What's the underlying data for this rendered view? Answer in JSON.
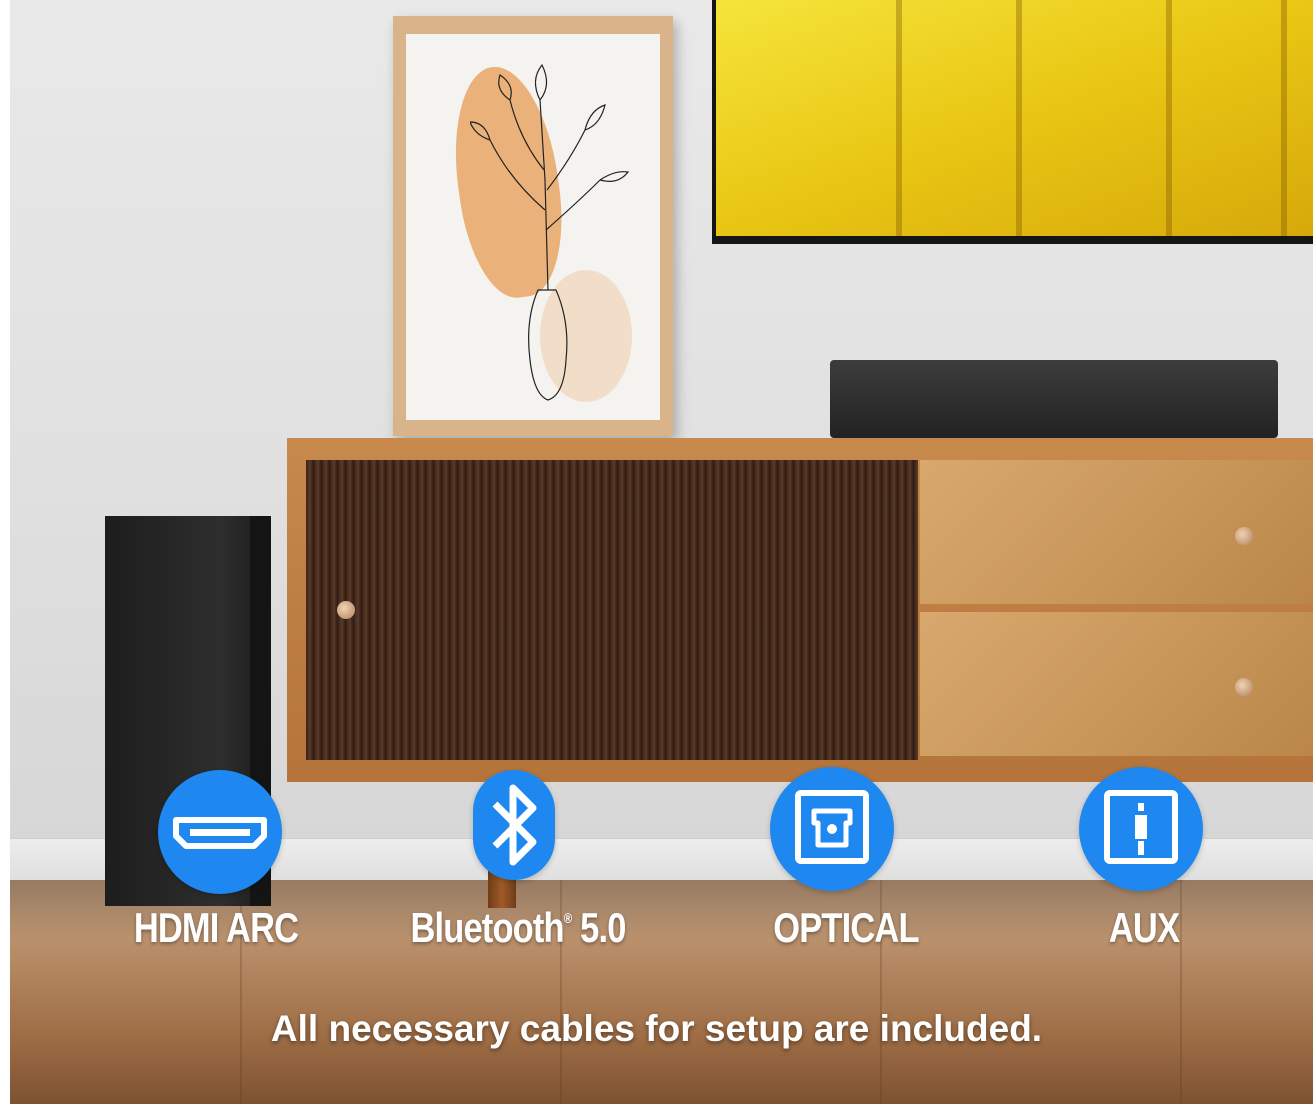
{
  "features": [
    {
      "name": "hdmi-arc",
      "label": "HDMI ARC",
      "icon": "hdmi-port-icon"
    },
    {
      "name": "bluetooth",
      "label": "Bluetooth",
      "sup": "®",
      "version": " 5.0",
      "icon": "bluetooth-icon"
    },
    {
      "name": "optical",
      "label": "OPTICAL",
      "icon": "optical-port-icon"
    },
    {
      "name": "aux",
      "label": "AUX",
      "icon": "aux-jack-icon"
    }
  ],
  "footer": "All necessary cables for setup are included.",
  "colors": {
    "icon_circle": "#1e88f0",
    "text": "#ffffff"
  }
}
